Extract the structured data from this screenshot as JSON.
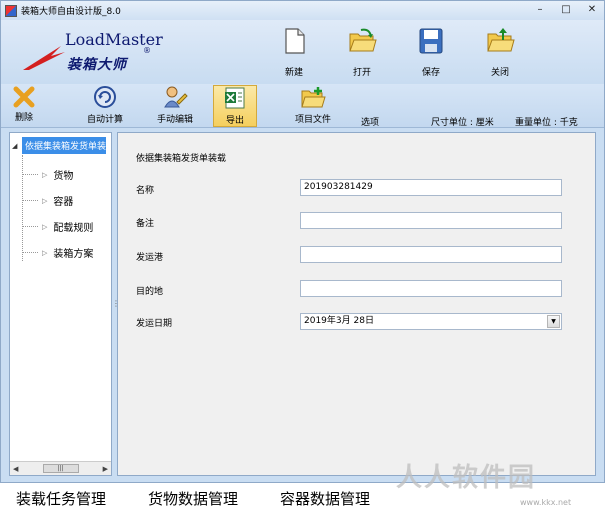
{
  "window": {
    "title": "装箱大师自由设计版_8.0",
    "minimize": "–",
    "maximize": "□",
    "close": "✕"
  },
  "logo": {
    "name_en": "LoadMaster",
    "name_cn": "装箱大师",
    "registered": "®"
  },
  "header_buttons": [
    {
      "label": "新建",
      "icon": "new-document-icon"
    },
    {
      "label": "打开",
      "icon": "open-folder-icon"
    },
    {
      "label": "保存",
      "icon": "save-disk-icon"
    },
    {
      "label": "关闭",
      "icon": "close-folder-icon"
    }
  ],
  "toolbar": {
    "items": [
      {
        "label": "删除",
        "icon": "delete-x-icon"
      },
      {
        "label": "自动计算",
        "icon": "auto-calc-icon"
      },
      {
        "label": "手动编辑",
        "icon": "manual-edit-icon"
      },
      {
        "label": "导出",
        "icon": "export-excel-icon",
        "active": true
      },
      {
        "label": "项目文件",
        "icon": "project-file-icon"
      }
    ],
    "options_label": "选项",
    "size_unit": "尺寸单位 : 厘米",
    "weight_unit": "重量单位 : 千克"
  },
  "tree": {
    "root": "依据集装箱发货单装载",
    "items": [
      "货物",
      "容器",
      "配载规则",
      "装箱方案"
    ]
  },
  "form": {
    "title": "依据集装箱发货单装载",
    "fields": [
      {
        "label": "名称",
        "value": "201903281429"
      },
      {
        "label": "备注",
        "value": ""
      },
      {
        "label": "发运港",
        "value": ""
      },
      {
        "label": "目的地",
        "value": ""
      }
    ],
    "date_label": "发运日期",
    "date_value": "2019年3月 28日"
  },
  "bottom_tabs": [
    "装载任务管理",
    "货物数据管理",
    "容器数据管理"
  ],
  "watermark": {
    "text": "人人软件园",
    "url": "www.kkx.net"
  },
  "colors": {
    "ribbon": "#c9ddf2",
    "active_button": "#f5cf5e",
    "tree_selection": "#3b8ee8",
    "logo_blue": "#0e1a70",
    "logo_red": "#d42020"
  }
}
